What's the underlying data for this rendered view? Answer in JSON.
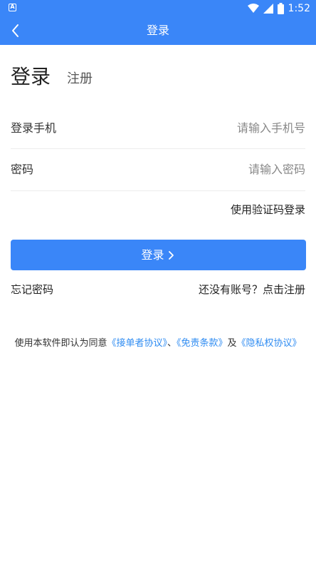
{
  "status_bar": {
    "app_indicator": "A",
    "time": "1:52",
    "icons": [
      "wifi-icon",
      "signal-icon",
      "battery-icon"
    ],
    "color": "#3a86f8"
  },
  "header": {
    "title": "登录",
    "back_icon": "chevron-left-icon",
    "background": "#3a86f8"
  },
  "tabs": {
    "login": "登录",
    "register": "注册"
  },
  "form": {
    "phone": {
      "label": "登录手机",
      "placeholder": "请输入手机号",
      "value": ""
    },
    "password": {
      "label": "密码",
      "placeholder": "请输入密码",
      "value": ""
    },
    "sms_login_label": "使用验证码登录",
    "submit_label": "登录",
    "submit_icon": "chevron-right-icon",
    "accent": "#3a86f8"
  },
  "links": {
    "forgot_password": "忘记密码",
    "register_prompt": "还没有账号？点击注册"
  },
  "agreement": {
    "prefix": "使用本软件即认为同意",
    "order_agreement": "《接单者协议》",
    "separator": "、",
    "disclaimer": "《免责条款》",
    "conjunction": "及",
    "privacy": "《隐私权协议》",
    "link_color": "#2f8cf2"
  }
}
